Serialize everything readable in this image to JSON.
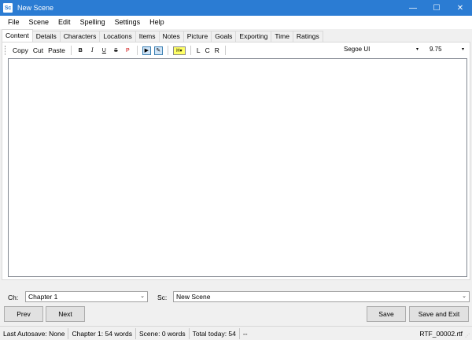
{
  "window": {
    "icon_text": "Sc",
    "title": "New Scene",
    "minimize_glyph": "—",
    "maximize_glyph": "☐",
    "close_glyph": "✕"
  },
  "menu": [
    "File",
    "Scene",
    "Edit",
    "Spelling",
    "Settings",
    "Help"
  ],
  "tabs": [
    {
      "label": "Content",
      "active": true
    },
    {
      "label": "Details"
    },
    {
      "label": "Characters"
    },
    {
      "label": "Locations"
    },
    {
      "label": "Items"
    },
    {
      "label": "Notes"
    },
    {
      "label": "Picture"
    },
    {
      "label": "Goals"
    },
    {
      "label": "Exporting"
    },
    {
      "label": "Time"
    },
    {
      "label": "Ratings"
    }
  ],
  "toolbar": {
    "copy": "Copy",
    "cut": "Cut",
    "paste": "Paste",
    "bold": "B",
    "italic": "I",
    "underline": "U",
    "strike": "S",
    "p": "P",
    "play_icon": "▶",
    "pen_icon": "✎",
    "highlight": "H▾",
    "align_left": "L",
    "align_center": "C",
    "align_right": "R",
    "font": "Segoe UI",
    "size": "9.75",
    "dropdown_arrow": "▾"
  },
  "editor": {
    "content": ""
  },
  "selectors": {
    "chapter_label": "Ch:",
    "chapter_value": "Chapter 1",
    "scene_label": "Sc:",
    "scene_value": "New Scene",
    "arrow": "⌄"
  },
  "buttons": {
    "prev": "Prev",
    "next": "Next",
    "save": "Save",
    "save_exit": "Save and Exit"
  },
  "status": {
    "autosave": "Last Autosave: None",
    "chapter": "Chapter 1: 54 words",
    "scene": "Scene: 0 words",
    "total": "Total today: 54",
    "extra": "--",
    "file": "RTF_00002.rtf",
    "grip": "⋰"
  }
}
